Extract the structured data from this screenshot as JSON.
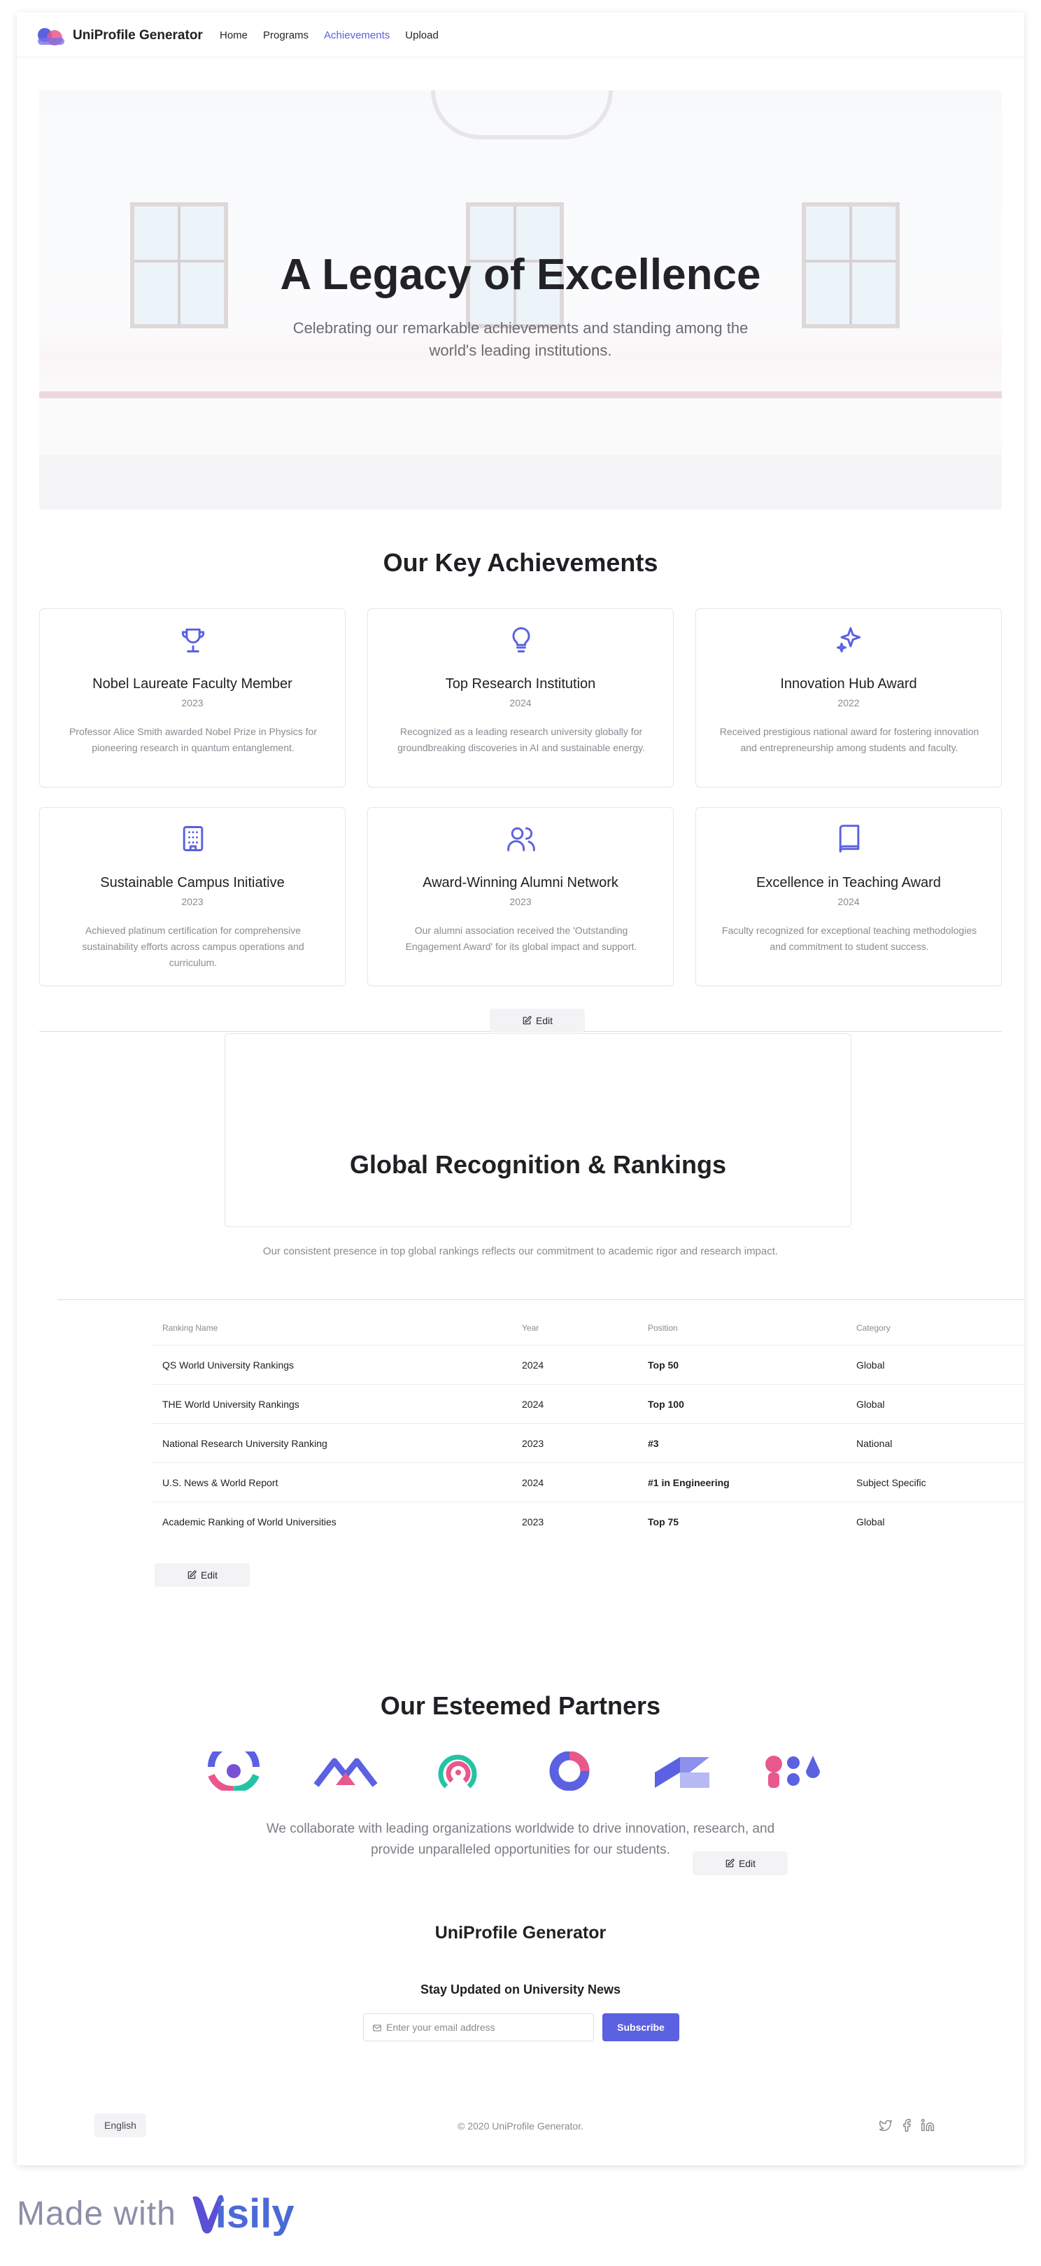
{
  "brand": "UniProfile Generator",
  "nav": [
    "Home",
    "Programs",
    "Achievements",
    "Upload"
  ],
  "nav_active": "Achievements",
  "hero": {
    "title": "A Legacy of Excellence",
    "subtitle": "Celebrating our remarkable achievements and standing among the world's leading institutions."
  },
  "achievements": {
    "title": "Our Key Achievements",
    "cards": [
      {
        "icon": "trophy-icon",
        "title": "Nobel Laureate Faculty Member",
        "year": "2023",
        "desc": "Professor Alice Smith awarded Nobel Prize in Physics for pioneering research in quantum entanglement."
      },
      {
        "icon": "lightbulb-icon",
        "title": "Top Research Institution",
        "year": "2024",
        "desc": "Recognized as a leading research university globally for groundbreaking discoveries in AI and sustainable energy."
      },
      {
        "icon": "sparkles-icon",
        "title": "Innovation Hub Award",
        "year": "2022",
        "desc": "Received prestigious national award for fostering innovation and entrepreneurship among students and faculty."
      },
      {
        "icon": "building-icon",
        "title": "Sustainable Campus Initiative",
        "year": "2023",
        "desc": "Achieved platinum certification for comprehensive sustainability efforts across campus operations and curriculum."
      },
      {
        "icon": "users-icon",
        "title": "Award-Winning Alumni Network",
        "year": "2023",
        "desc": "Our alumni association received the 'Outstanding Engagement Award' for its global impact and support."
      },
      {
        "icon": "book-icon",
        "title": "Excellence in Teaching Award",
        "year": "2024",
        "desc": "Faculty recognized for exceptional teaching methodologies and commitment to student success."
      }
    ],
    "edit_label": "Edit"
  },
  "rankings": {
    "title": "Global Recognition & Rankings",
    "subtitle": "Our consistent presence in top global rankings reflects our commitment to academic rigor and research impact.",
    "columns": [
      "Ranking Name",
      "Year",
      "Position",
      "Category"
    ],
    "rows": [
      [
        "QS World University Rankings",
        "2024",
        "Top 50",
        "Global"
      ],
      [
        "THE World University Rankings",
        "2024",
        "Top 100",
        "Global"
      ],
      [
        "National Research University Ranking",
        "2023",
        "#3",
        "National"
      ],
      [
        "U.S. News & World Report",
        "2024",
        "#1 in Engineering",
        "Subject Specific"
      ],
      [
        "Academic Ranking of World Universities",
        "2023",
        "Top 75",
        "Global"
      ]
    ],
    "edit_label": "Edit"
  },
  "partners": {
    "title": "Our Esteemed Partners",
    "text": "We collaborate with leading organizations worldwide to drive innovation, research, and provide unparalleled opportunities for our students.",
    "edit_label": "Edit"
  },
  "footer": {
    "brand": "UniProfile Generator",
    "news_title": "Stay Updated on University News",
    "email_placeholder": "Enter your email address",
    "subscribe_label": "Subscribe",
    "language": "English",
    "copyright": "© 2020 UniProfile Generator."
  },
  "watermark": {
    "made_with": "Made with",
    "logo_text": "Visily"
  },
  "colors": {
    "accent": "#5b61e0",
    "pink": "#e8588c",
    "teal": "#25c3a5"
  }
}
